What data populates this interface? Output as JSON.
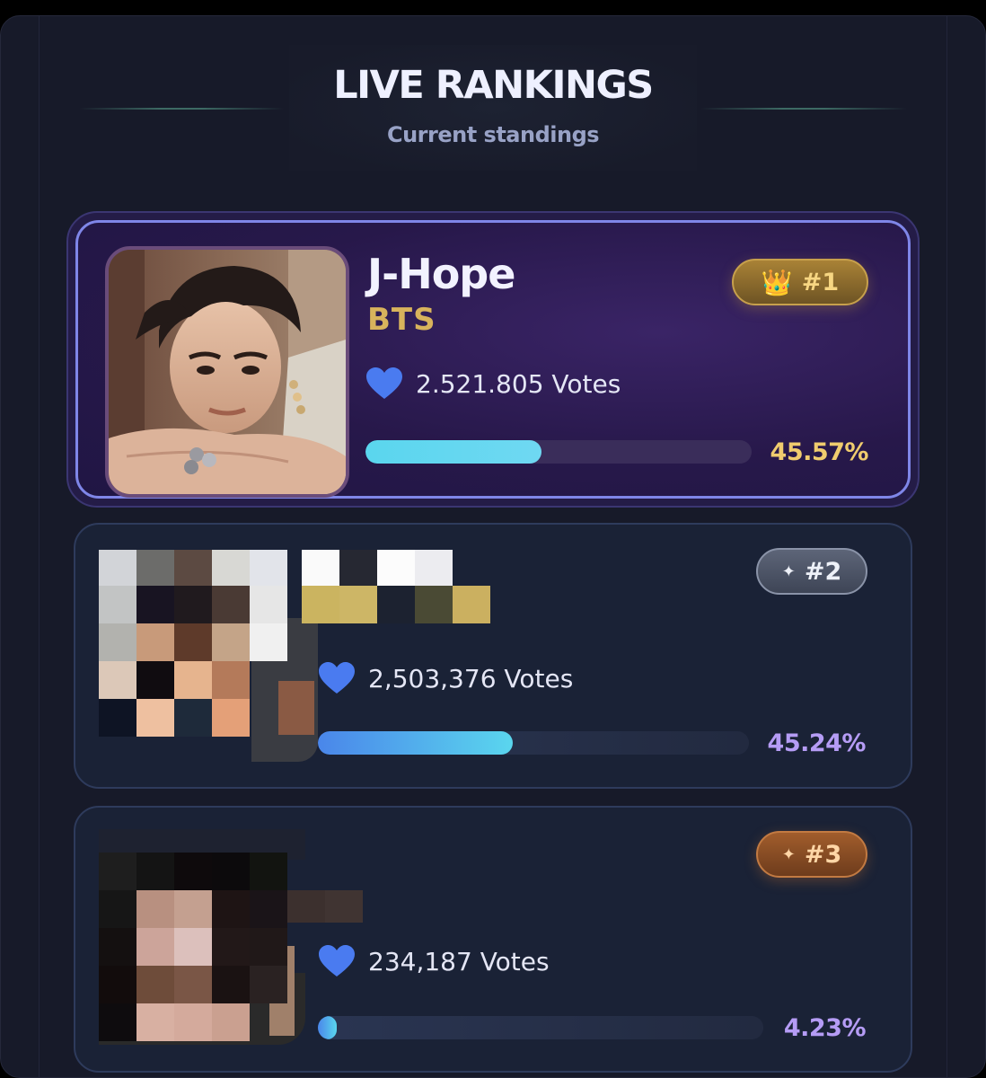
{
  "header": {
    "title": "LIVE RANKINGS",
    "subtitle": "Current standings"
  },
  "colors": {
    "panel": "#171a29",
    "first_card": "#27184a",
    "first_border": "#7f86e8",
    "card": "#1a2236",
    "gold_text": "#f7d682",
    "group_gold": "#d8b35c",
    "pct_gold": "#f0cc6e",
    "pct_violet": "#b59cf5",
    "bar_cyan": "#5ad6ee",
    "bar_blue": "#4a86ea",
    "heart_blue": "#4a7bf0"
  },
  "rankings": [
    {
      "rank_label": "#1",
      "badge_icon": "crown-icon",
      "badge_glyph": "👑",
      "name": "J-Hope",
      "group": "BTS",
      "votes": "2.521.805 Votes",
      "percent_label": "45.57%",
      "percent": 45.57
    },
    {
      "rank_label": "#2",
      "badge_icon": "sparkle-icon",
      "badge_glyph": "✦",
      "votes": "2,503,376 Votes",
      "percent_label": "45.24%",
      "percent": 45.24
    },
    {
      "rank_label": "#3",
      "badge_icon": "sparkle-icon",
      "badge_glyph": "✦",
      "votes": "234,187 Votes",
      "percent_label": "4.23%",
      "percent": 4.23
    }
  ]
}
